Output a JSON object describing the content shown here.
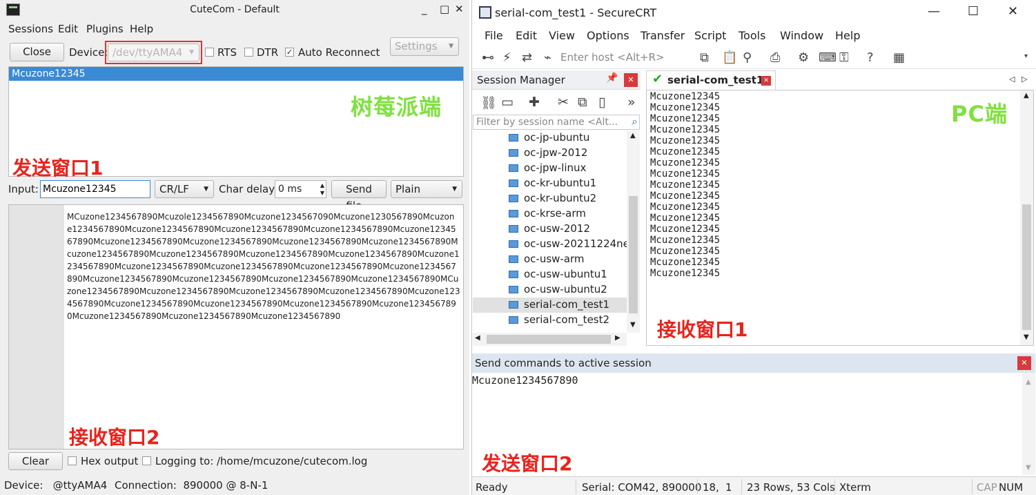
{
  "cutecom": {
    "title": "CuteCom - Default",
    "menu": [
      "Sessions",
      "Edit",
      "Plugins",
      "Help"
    ],
    "close_button": "Close",
    "device_label": "Device:",
    "device_value": "/dev/ttyAMA4",
    "rts_label": "RTS",
    "dtr_label": "DTR",
    "auto_reconnect_label": "Auto Reconnect",
    "auto_reconnect_checked": "✓",
    "settings_button": "Settings",
    "history_item": "Mcuzone12345",
    "overlay_pi": "树莓派端",
    "overlay_send1": "发送窗口1",
    "input_label": "Input:",
    "input_value": "Mcuzone12345",
    "line_end": "CR/LF",
    "char_delay_label": "Char delay:",
    "char_delay_value": "0 ms",
    "send_file_button": "Send file...",
    "format_value": "Plain",
    "output_lines": [
      "MCuzone1234567890Mcuzole1234567890Mcuzone1234567090Mcuzone1230567890Mcuzon",
      "e1234567890Mcuzone1234567890Mcuzone1234567890Mcuzone1234567890Mcuzone12345",
      "67890Mcuzone1234567890Mcuzone1234567890Mcuzone1234567890Mcuzone1234567890M",
      "cuzone1234567890Mcuzone1234567890Mcuzone1234567890Mcuzone1234567890Mcuzone1",
      "234567890Mcuzone1234567890Mcuzone1234567890Mcuzone1234567890Mcuzone1234567",
      "890Mcuzone1234567890Mcuzone1234567890Mcuzone1234567890Mcuzone1234567890MCu",
      "zone1234567890Mcuzone1234567890Mcuzone1234567890Mcuzone1234567890Mcuzone123",
      "4567890Mcuzone1234567890Mcuzone1234567890Mcuzone1234567890Mcuzone123456789",
      "0Mcuzone1234567890Mcuzone1234567890Mcuzone1234567890"
    ],
    "overlay_recv2": "接收窗口2",
    "clear_button": "Clear",
    "hex_output_label": "Hex output",
    "logging_label": "Logging to:",
    "log_path": "/home/mcuzone/cutecom.log",
    "status_device": "Device:   @ttyAMA4",
    "status_connection": "Connection:  890000 @ 8-N-1"
  },
  "securecrt": {
    "title": "serial-com_test1 - SecureCRT",
    "menu": [
      "File",
      "Edit",
      "View",
      "Options",
      "Transfer",
      "Script",
      "Tools",
      "Window",
      "Help"
    ],
    "host_placeholder": "Enter host <Alt+R>",
    "session_manager_title": "Session Manager",
    "filter_placeholder": "Filter by session name <Alt...",
    "sessions": [
      "oc-jp-ubuntu",
      "oc-jpw-2012",
      "oc-jpw-linux",
      "oc-kr-ubuntu1",
      "oc-kr-ubuntu2",
      "oc-krse-arm",
      "oc-usw-2012",
      "oc-usw-20211224ne",
      "oc-usw-arm",
      "oc-usw-ubuntu1",
      "oc-usw-ubuntu2",
      "serial-com_test1",
      "serial-com_test2"
    ],
    "tab_label": "serial-com_test1",
    "overlay_pc": "PC端",
    "terminal_lines": [
      "Mcuzone12345",
      "Mcuzone12345",
      "Mcuzone12345",
      "Mcuzone12345",
      "Mcuzone12345",
      "Mcuzone12345",
      "Mcuzone12345",
      "Mcuzone12345",
      "Mcuzone12345",
      "Mcuzone12345",
      "Mcuzone12345",
      "Mcuzone12345",
      "Mcuzone12345",
      "Mcuzone12345",
      "Mcuzone12345",
      "Mcuzone12345",
      "Mcuzone12345"
    ],
    "overlay_recv1": "接收窗口1",
    "command_header": "Send commands to active session",
    "command_text": "Mcuzone1234567890",
    "overlay_send2": "发送窗口2",
    "status": {
      "ready": "Ready",
      "serial": "Serial: COM42, 890000",
      "pos_row": "18,",
      "pos_col": "1",
      "size": "23 Rows, 53 Cols",
      "term": "Xterm",
      "cap": "CAP",
      "num": "NUM"
    }
  },
  "colors": {
    "selection_blue": "#3a8ad4",
    "overlay_green": "#7fe13f",
    "overlay_red": "#e8231c",
    "highlight_red_box": "#e03030"
  }
}
